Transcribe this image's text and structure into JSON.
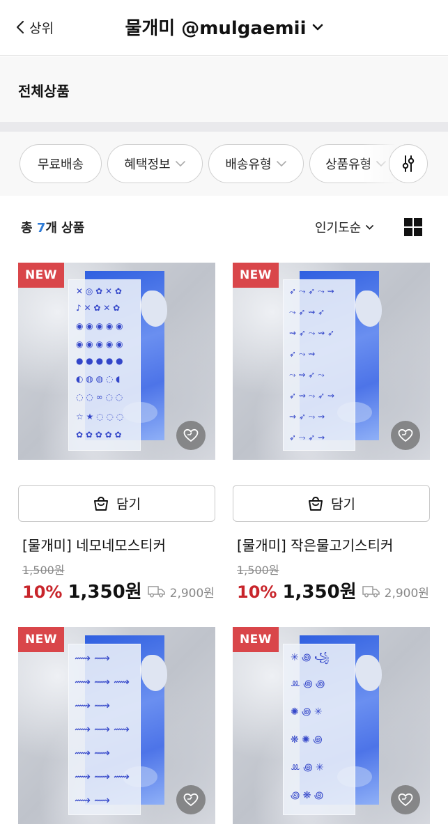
{
  "header": {
    "back_label": "상위",
    "title": "물개미 @mulgaemii"
  },
  "category": {
    "label": "전체상품"
  },
  "filters": [
    {
      "label": "무료배송",
      "dropdown": false
    },
    {
      "label": "혜택정보",
      "dropdown": true
    },
    {
      "label": "배송유형",
      "dropdown": true
    },
    {
      "label": "상품유형",
      "dropdown": true
    }
  ],
  "summary": {
    "count_prefix": "총 ",
    "count_number": "7",
    "count_suffix": "개 상품",
    "sort_label": "인기도순"
  },
  "products": [
    {
      "badge": "NEW",
      "cart_label": "담기",
      "name": "[물개미] 네모네모스티커",
      "original_price": "1,500원",
      "discount": "10%",
      "sale_price": "1,350원",
      "shipping_fee": "2,900원"
    },
    {
      "badge": "NEW",
      "cart_label": "담기",
      "name": "[물개미] 작은물고기스티커",
      "original_price": "1,500원",
      "discount": "10%",
      "sale_price": "1,350원",
      "shipping_fee": "2,900원"
    },
    {
      "badge": "NEW"
    },
    {
      "badge": "NEW"
    }
  ],
  "colors": {
    "badge_red": "#d9464a",
    "discount_red": "#c8252b",
    "count_blue": "#2e7bd6",
    "sticker_blue": "#3346c9"
  },
  "icons": {
    "back": "chevron-left-icon",
    "title_dropdown": "chevron-down-icon",
    "settings": "sliders-icon",
    "view": "grid-view-icon",
    "wish": "heart-icon",
    "cart": "shopping-bag-icon",
    "shipping": "truck-icon"
  }
}
